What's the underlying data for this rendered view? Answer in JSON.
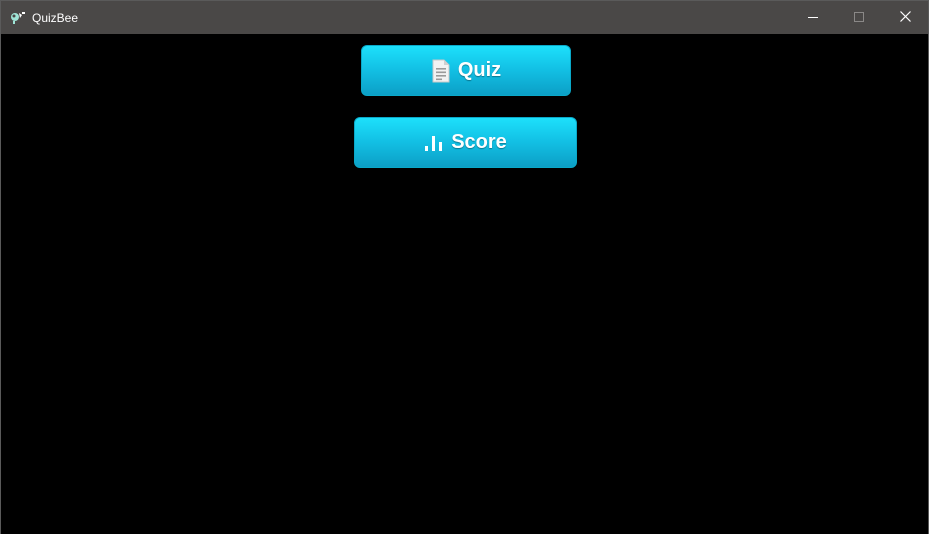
{
  "window": {
    "title": "QuizBee",
    "controls": {
      "minimize_icon": "minimize-icon",
      "maximize_icon": "maximize-icon",
      "close_icon": "close-icon"
    },
    "titlebar_color": "#4a4847",
    "background_color": "#000000"
  },
  "menu": {
    "quiz": {
      "label": "Quiz",
      "icon": "document-icon"
    },
    "score": {
      "label": "Score",
      "icon": "bar-chart-icon"
    },
    "button_color": "#13c2e6"
  }
}
